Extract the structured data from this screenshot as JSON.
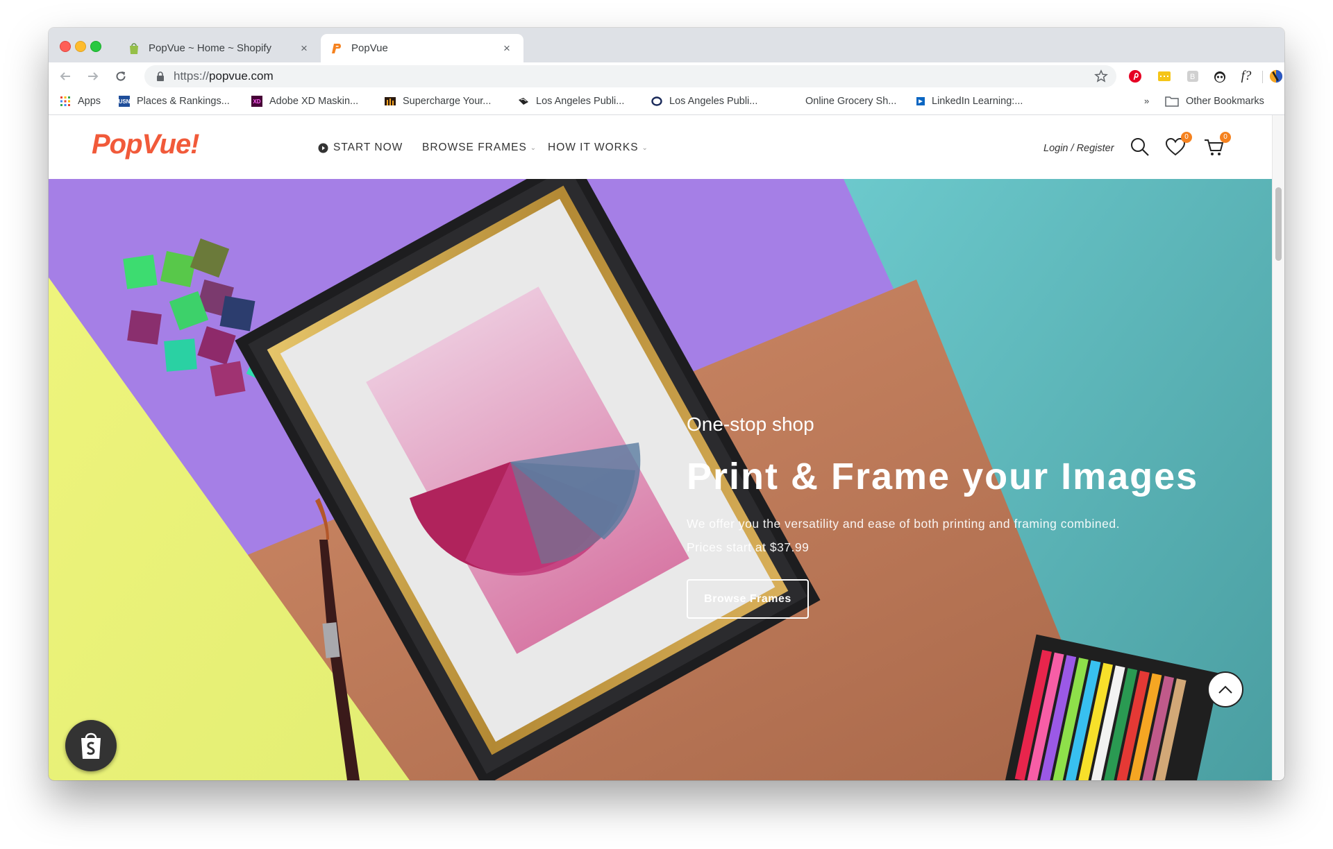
{
  "browser": {
    "tabs": [
      {
        "title": "PopVue ~ Home ~ Shopify",
        "favicon": "shopify-bag-icon",
        "active": false
      },
      {
        "title": "PopVue",
        "favicon": "popvue-p-icon",
        "active": true
      }
    ],
    "close_glyph": "×",
    "url_scheme": "https://",
    "url_host": "popvue.com",
    "bookmarks": [
      {
        "label": "Apps",
        "icon": "apps-grid-icon"
      },
      {
        "label": "Places & Rankings...",
        "icon": "usn-icon"
      },
      {
        "label": "Adobe XD Maskin...",
        "icon": "adobe-xd-icon"
      },
      {
        "label": "Supercharge Your...",
        "icon": "supercharge-icon"
      },
      {
        "label": "Los Angeles Publi...",
        "icon": "la-public-library-icon"
      },
      {
        "label": "Los Angeles Publi...",
        "icon": "overdrive-icon"
      },
      {
        "label": "Online Grocery Sh...",
        "icon": "grocery-icon"
      },
      {
        "label": "LinkedIn Learning:...",
        "icon": "linkedin-learning-icon"
      }
    ],
    "bookmarks_overflow": "»",
    "other_bookmarks": "Other Bookmarks",
    "ext_font_label": "f?"
  },
  "header": {
    "logo": "PopVue!",
    "nav": [
      {
        "label": "START NOW",
        "icon": "play-circle-icon",
        "dropdown": false
      },
      {
        "label": "BROWSE FRAMES",
        "dropdown": true
      },
      {
        "label": "HOW IT WORKS",
        "dropdown": true
      }
    ],
    "login": "Login / Register",
    "wishlist_count": "0",
    "cart_count": "0"
  },
  "hero": {
    "kicker": "One-stop shop",
    "headline": "Print & Frame your Images",
    "desc_line1": "We offer you the versatility and ease of both printing and framing combined.",
    "desc_line2": "Prices start at $37.99",
    "cta": "Browse Frames"
  },
  "colors": {
    "brand": "#f15a3a",
    "badge": "#f5821f",
    "hero_purple": "#a27fe8",
    "hero_yellow": "#eaf27a",
    "hero_teal": "#5fb9be",
    "hero_terracotta": "#c98562"
  }
}
